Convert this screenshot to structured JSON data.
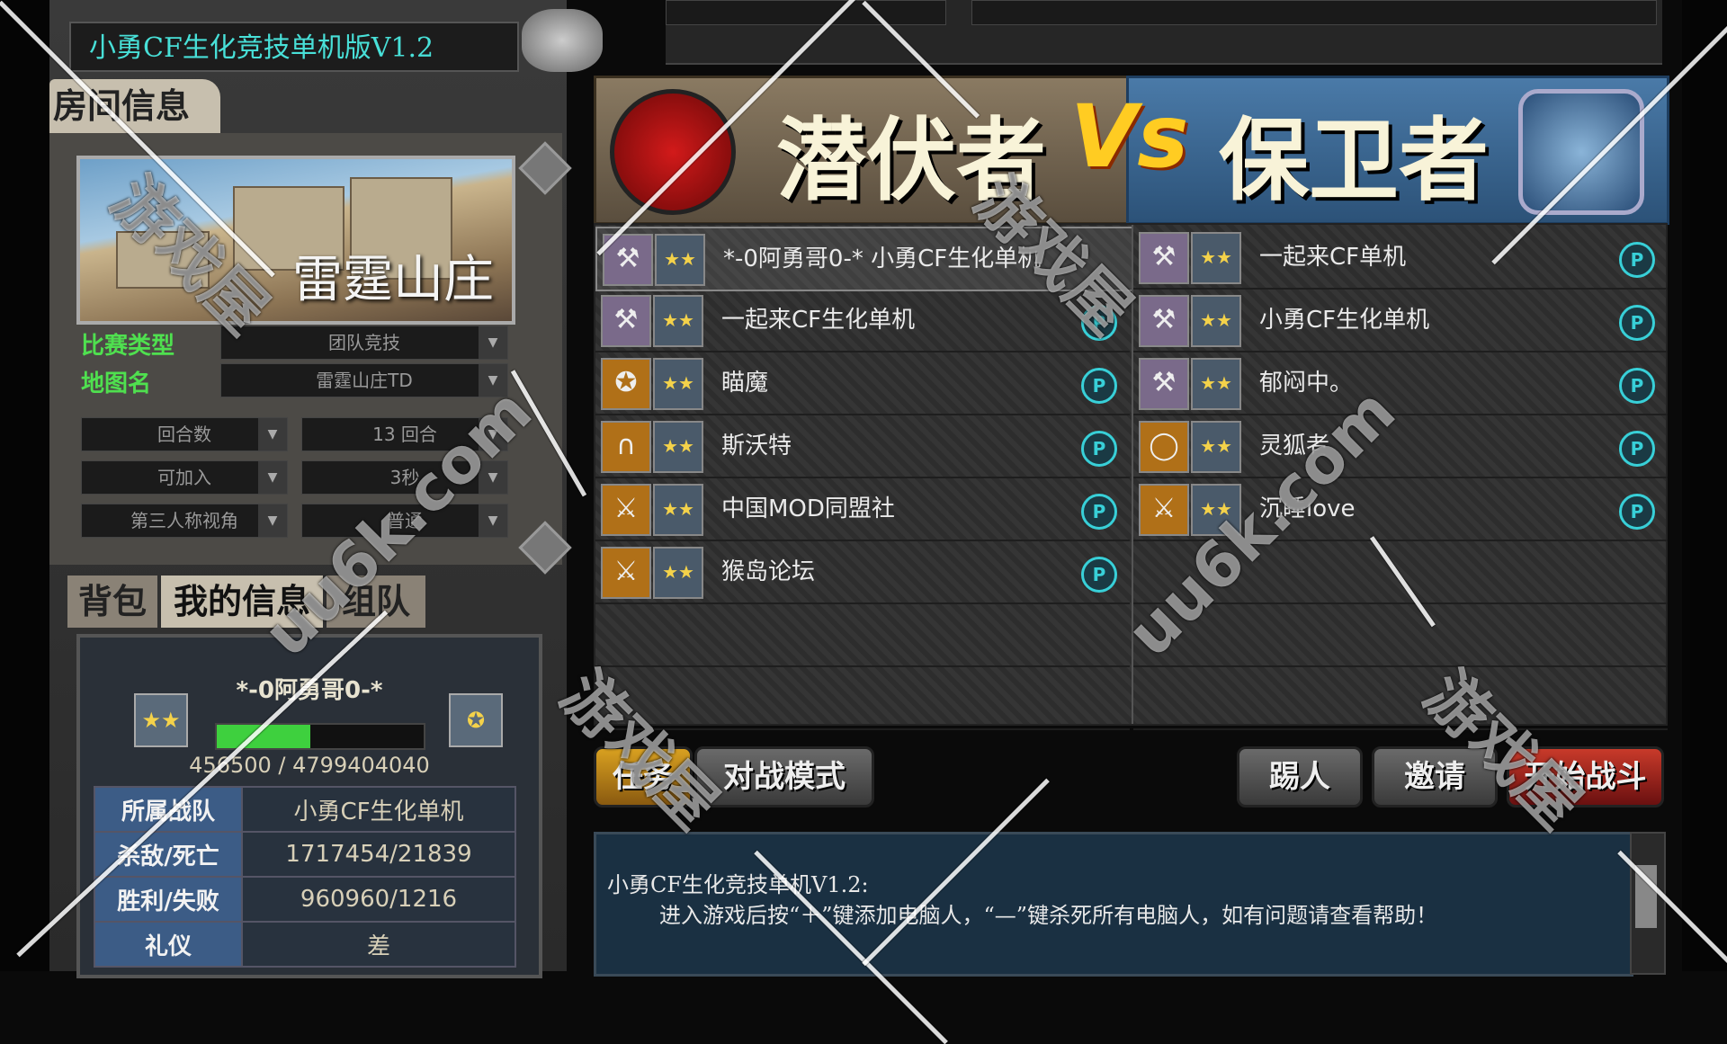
{
  "window": {
    "title": "小勇CF生化竞技单机版V1.2"
  },
  "room": {
    "tab_label": "房间信息",
    "map_name": "雷霆山庄",
    "match_type_label": "比赛类型",
    "match_type_value": "团队竞技",
    "map_label": "地图名",
    "map_value": "雷霆山庄TD",
    "rounds_label": "回合数",
    "rounds_value": "13 回合",
    "joinable_label": "可加入",
    "joinable_value": "3秒",
    "view_label": "第三人称视角",
    "view_value": "普通"
  },
  "info_tabs": {
    "bag": "背包",
    "my_info": "我的信息",
    "team": "组队"
  },
  "player": {
    "name": "*-0阿勇哥0-*",
    "xp_text": "456500 / 4799404040",
    "xp_fill": 0.45,
    "stats": [
      {
        "key": "所属战队",
        "value": "小勇CF生化单机"
      },
      {
        "key": "杀敌/死亡",
        "value": "1717454/21839"
      },
      {
        "key": "胜利/失败",
        "value": "960960/1216"
      },
      {
        "key": "礼仪",
        "value": "差"
      }
    ]
  },
  "teams": {
    "left_name": "潜伏者",
    "vs": "Vs",
    "right_name": "保卫者"
  },
  "left_players": [
    {
      "name": "*-0阿勇哥0-*  小勇CF生化单机",
      "p": "",
      "weapon": "axe-icon",
      "highlight": true
    },
    {
      "name": "一起来CF生化单机",
      "p": "P",
      "weapon": "axe-icon"
    },
    {
      "name": "瞄魔",
      "p": "P",
      "weapon": "star-icon"
    },
    {
      "name": "斯沃特",
      "p": "P",
      "weapon": "arch-icon"
    },
    {
      "name": "中国MOD同盟社",
      "p": "P",
      "weapon": "double-axe-icon"
    },
    {
      "name": "猴岛论坛",
      "p": "P",
      "weapon": "double-axe-icon"
    }
  ],
  "right_players": [
    {
      "name": "一起来CF单机",
      "p": "P",
      "weapon": "axe-icon"
    },
    {
      "name": "小勇CF生化单机",
      "p": "P",
      "weapon": "axe-icon"
    },
    {
      "name": "郁闷中。",
      "p": "P",
      "weapon": "axe-icon"
    },
    {
      "name": "灵狐者",
      "p": "P",
      "weapon": "ring-icon"
    },
    {
      "name": "沉睡love",
      "p": "P",
      "weapon": "double-axe-icon"
    }
  ],
  "buttons": {
    "mission": "任务",
    "mode": "对战模式",
    "kick": "踢人",
    "invite": "邀请",
    "start": "开始战斗"
  },
  "chat": {
    "line1": "小勇CF生化竞技单机V1.2:",
    "line2": "进入游戏后按“＋”键添加电脑人，“—”键杀死所有电脑人，如有问题请查看帮助！"
  },
  "watermark": {
    "brand": "游戏屋",
    "site": "uu6k.com"
  },
  "colors": {
    "title_cyan": "#48e0d8",
    "label_green": "#4fe04f",
    "badge_cyan": "#38d0d8",
    "vs_gold": "#ffcc22"
  }
}
